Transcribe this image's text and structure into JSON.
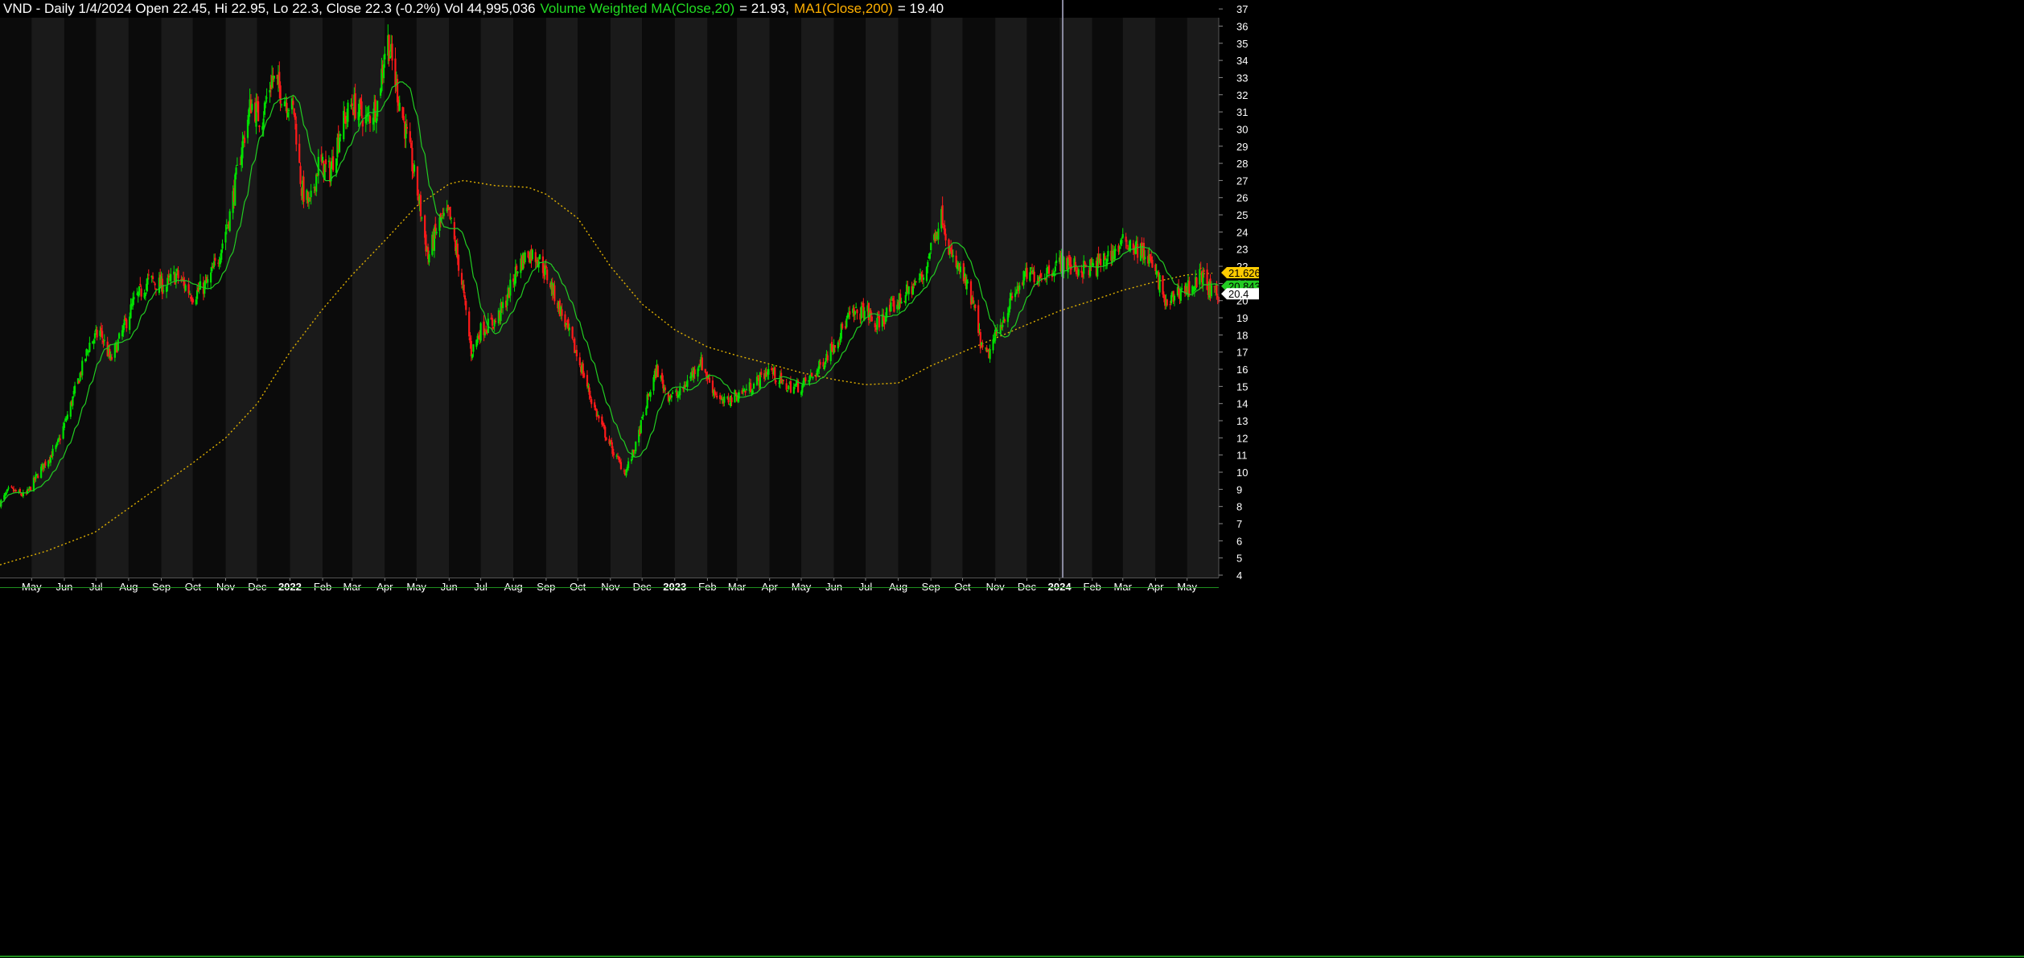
{
  "header": {
    "main": "VND - Daily 1/4/2024 Open 22.45, Hi 22.95, Lo 22.3, Close 22.3 (-0.2%) Vol 44,995,036",
    "vwma_label": "Volume Weighted MA(Close,20)",
    "vwma_value": "= 21.93,",
    "ma_label": "MA1(Close,200)",
    "ma_value": "= 19.40"
  },
  "colors": {
    "background": "#000000",
    "band_dark": "#0b0b0b",
    "band_light": "#1a1a1a",
    "up_candle": "#00e000",
    "down_candle": "#ff1a1a",
    "vwma_line": "#22cc22",
    "ma200_line": "#e0b000",
    "axis_text": "#ffffff",
    "cursor_line": "#8a8aa0"
  },
  "price_tags": [
    {
      "label": "21.626",
      "value": 21.626,
      "bg": "#ffcc00",
      "fg": "#000000"
    },
    {
      "label": "20.8432",
      "value": 20.8432,
      "bg": "#22cc22",
      "fg": "#000000"
    },
    {
      "label": "20.4",
      "value": 20.4,
      "bg": "#ffffff",
      "fg": "#000000"
    }
  ],
  "x_axis_labels": [
    "May",
    "Jun",
    "Jul",
    "Aug",
    "Sep",
    "Oct",
    "Nov",
    "Dec",
    "2022",
    "Feb",
    "Mar",
    "Apr",
    "May",
    "Jun",
    "Jul",
    "Aug",
    "Sep",
    "Oct",
    "Nov",
    "Dec",
    "2023",
    "Feb",
    "Mar",
    "Apr",
    "May",
    "Jun",
    "Jul",
    "Aug",
    "Sep",
    "Oct",
    "Nov",
    "Dec",
    "2024",
    "Feb",
    "Mar",
    "Apr",
    "May"
  ],
  "chart_data": {
    "type": "candlestick",
    "title": "VND - Daily",
    "y_axis": {
      "min": 4,
      "max": 37,
      "ticks": [
        4,
        5,
        6,
        7,
        8,
        9,
        10,
        11,
        12,
        13,
        14,
        15,
        16,
        17,
        18,
        19,
        20,
        21,
        22,
        23,
        24,
        25,
        26,
        27,
        28,
        29,
        30,
        31,
        32,
        33,
        34,
        35,
        36,
        37
      ],
      "position": "right"
    },
    "x_axis": {
      "type": "date",
      "start": "2021-04-01",
      "end": "2024-05-31",
      "month_labels": [
        "May",
        "Jun",
        "Jul",
        "Aug",
        "Sep",
        "Oct",
        "Nov",
        "Dec",
        "2022",
        "Feb",
        "Mar",
        "Apr",
        "May",
        "Jun",
        "Jul",
        "Aug",
        "Sep",
        "Oct",
        "Nov",
        "Dec",
        "2023",
        "Feb",
        "Mar",
        "Apr",
        "May",
        "Jun",
        "Jul",
        "Aug",
        "Sep",
        "Oct",
        "Nov",
        "Dec",
        "2024",
        "Feb",
        "Mar",
        "Apr",
        "May"
      ]
    },
    "grid": "alternating monthly background bands",
    "price_path": [
      [
        "2021-04-01",
        8.2
      ],
      [
        "2021-04-10",
        9.0
      ],
      [
        "2021-04-25",
        8.6
      ],
      [
        "2021-05-10",
        10.2
      ],
      [
        "2021-05-25",
        11.5
      ],
      [
        "2021-06-05",
        13.5
      ],
      [
        "2021-06-15",
        15.5
      ],
      [
        "2021-06-25",
        17.5
      ],
      [
        "2021-07-05",
        18.2
      ],
      [
        "2021-07-15",
        16.5
      ],
      [
        "2021-07-25",
        18.0
      ],
      [
        "2021-08-05",
        19.8
      ],
      [
        "2021-08-20",
        21.2
      ],
      [
        "2021-09-05",
        20.8
      ],
      [
        "2021-09-15",
        21.5
      ],
      [
        "2021-10-01",
        20.3
      ],
      [
        "2021-10-15",
        21.0
      ],
      [
        "2021-10-25",
        22.5
      ],
      [
        "2021-11-05",
        25.0
      ],
      [
        "2021-11-15",
        28.5
      ],
      [
        "2021-11-25",
        31.5
      ],
      [
        "2021-12-05",
        30.5
      ],
      [
        "2021-12-15",
        33.0
      ],
      [
        "2021-12-25",
        32.0
      ],
      [
        "2022-01-05",
        31.0
      ],
      [
        "2022-01-12",
        26.5
      ],
      [
        "2022-01-20",
        25.5
      ],
      [
        "2022-01-28",
        28.0
      ],
      [
        "2022-02-08",
        27.5
      ],
      [
        "2022-02-18",
        30.0
      ],
      [
        "2022-03-01",
        31.5
      ],
      [
        "2022-03-15",
        30.5
      ],
      [
        "2022-03-25",
        31.5
      ],
      [
        "2022-04-03",
        35.5
      ],
      [
        "2022-04-12",
        32.5
      ],
      [
        "2022-04-22",
        29.5
      ],
      [
        "2022-05-03",
        26.0
      ],
      [
        "2022-05-12",
        22.5
      ],
      [
        "2022-05-22",
        24.5
      ],
      [
        "2022-06-01",
        25.0
      ],
      [
        "2022-06-12",
        21.5
      ],
      [
        "2022-06-22",
        17.0
      ],
      [
        "2022-07-01",
        18.3
      ],
      [
        "2022-07-15",
        18.8
      ],
      [
        "2022-07-25",
        20.0
      ],
      [
        "2022-08-05",
        22.0
      ],
      [
        "2022-08-15",
        22.8
      ],
      [
        "2022-08-25",
        22.5
      ],
      [
        "2022-09-05",
        21.0
      ],
      [
        "2022-09-20",
        18.5
      ],
      [
        "2022-10-05",
        16.0
      ],
      [
        "2022-10-15",
        14.0
      ],
      [
        "2022-10-25",
        12.5
      ],
      [
        "2022-11-05",
        11.0
      ],
      [
        "2022-11-15",
        10.0
      ],
      [
        "2022-11-25",
        11.5
      ],
      [
        "2022-12-05",
        14.0
      ],
      [
        "2022-12-15",
        16.0
      ],
      [
        "2022-12-25",
        14.5
      ],
      [
        "2023-01-05",
        14.5
      ],
      [
        "2023-01-15",
        15.5
      ],
      [
        "2023-01-25",
        16.5
      ],
      [
        "2023-02-05",
        15.0
      ],
      [
        "2023-02-15",
        14.0
      ],
      [
        "2023-03-01",
        14.5
      ],
      [
        "2023-03-15",
        15.0
      ],
      [
        "2023-04-01",
        16.0
      ],
      [
        "2023-04-15",
        15.0
      ],
      [
        "2023-05-01",
        15.0
      ],
      [
        "2023-05-15",
        15.8
      ],
      [
        "2023-06-01",
        17.5
      ],
      [
        "2023-06-15",
        19.0
      ],
      [
        "2023-07-01",
        19.5
      ],
      [
        "2023-07-10",
        18.5
      ],
      [
        "2023-07-25",
        19.5
      ],
      [
        "2023-08-10",
        20.5
      ],
      [
        "2023-08-25",
        21.5
      ],
      [
        "2023-09-05",
        24.0
      ],
      [
        "2023-09-12",
        25.0
      ],
      [
        "2023-09-20",
        22.5
      ],
      [
        "2023-10-01",
        21.5
      ],
      [
        "2023-10-12",
        19.5
      ],
      [
        "2023-10-20",
        17.0
      ],
      [
        "2023-10-25",
        16.8
      ],
      [
        "2023-11-05",
        18.5
      ],
      [
        "2023-11-20",
        20.5
      ],
      [
        "2023-12-01",
        21.5
      ],
      [
        "2023-12-15",
        21.5
      ],
      [
        "2024-01-04",
        22.3
      ],
      [
        "2024-01-20",
        21.8
      ],
      [
        "2024-02-05",
        22.0
      ],
      [
        "2024-02-20",
        22.8
      ],
      [
        "2024-03-05",
        23.5
      ],
      [
        "2024-03-15",
        23.0
      ],
      [
        "2024-03-25",
        22.5
      ],
      [
        "2024-04-05",
        21.0
      ],
      [
        "2024-04-12",
        19.5
      ],
      [
        "2024-04-20",
        20.5
      ],
      [
        "2024-05-05",
        20.8
      ],
      [
        "2024-05-15",
        21.5
      ],
      [
        "2024-05-25",
        20.3
      ]
    ],
    "series": [
      {
        "name": "Volume Weighted MA(Close,20)",
        "last_value": 21.93,
        "axis_tag": 20.8432,
        "type": "line"
      },
      {
        "name": "MA1(Close,200)",
        "last_value": 19.4,
        "axis_tag": 21.626,
        "type": "dotted-line",
        "values": [
          [
            "2021-04-01",
            4.6
          ],
          [
            "2021-05-15",
            5.4
          ],
          [
            "2021-06-30",
            6.5
          ],
          [
            "2021-08-15",
            8.5
          ],
          [
            "2021-09-30",
            10.5
          ],
          [
            "2021-11-01",
            12.0
          ],
          [
            "2021-12-01",
            14.0
          ],
          [
            "2022-01-01",
            17.0
          ],
          [
            "2022-02-01",
            19.5
          ],
          [
            "2022-03-01",
            21.5
          ],
          [
            "2022-04-01",
            23.5
          ],
          [
            "2022-05-01",
            25.5
          ],
          [
            "2022-06-01",
            26.8
          ],
          [
            "2022-06-15",
            27.0
          ],
          [
            "2022-07-15",
            26.7
          ],
          [
            "2022-08-15",
            26.6
          ],
          [
            "2022-09-01",
            26.2
          ],
          [
            "2022-10-01",
            24.8
          ],
          [
            "2022-11-01",
            22.0
          ],
          [
            "2022-12-01",
            19.8
          ],
          [
            "2023-01-01",
            18.3
          ],
          [
            "2023-02-01",
            17.3
          ],
          [
            "2023-03-01",
            16.8
          ],
          [
            "2023-04-01",
            16.3
          ],
          [
            "2023-05-01",
            15.8
          ],
          [
            "2023-06-01",
            15.4
          ],
          [
            "2023-07-01",
            15.1
          ],
          [
            "2023-08-01",
            15.2
          ],
          [
            "2023-09-01",
            16.2
          ],
          [
            "2023-10-01",
            17.0
          ],
          [
            "2023-11-01",
            17.8
          ],
          [
            "2023-12-01",
            18.6
          ],
          [
            "2024-01-01",
            19.4
          ],
          [
            "2024-02-01",
            20.0
          ],
          [
            "2024-03-01",
            20.6
          ],
          [
            "2024-04-01",
            21.1
          ],
          [
            "2024-05-01",
            21.5
          ],
          [
            "2024-05-25",
            21.6
          ]
        ]
      }
    ],
    "last_close": 20.4,
    "cursor_date": "2024-01-04"
  }
}
